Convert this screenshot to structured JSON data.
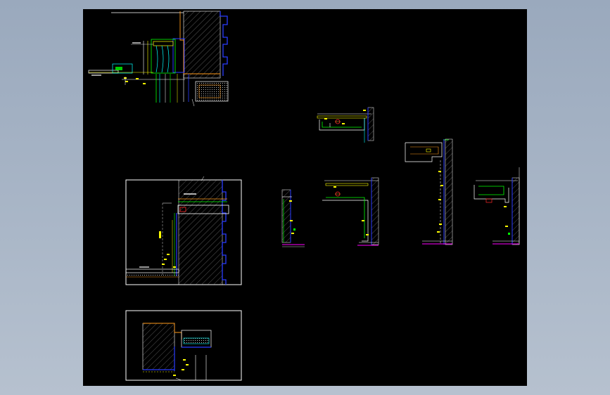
{
  "viewport": {
    "background": "#a6b3c5",
    "canvas_color": "#000000"
  },
  "palette": {
    "white": "#ffffff",
    "yellow": "#ffff00",
    "green": "#00ff00",
    "cyan": "#00ffff",
    "blue": "#2a3cff",
    "orange": "#ff9a1a",
    "red": "#ff2a2a",
    "magenta": "#ff00ff",
    "gray": "#8c8c8c"
  },
  "details": [
    {
      "name": "wall-section-top-left",
      "kind": "section"
    },
    {
      "name": "wall-section-middle-left",
      "kind": "detail"
    },
    {
      "name": "wall-section-bottom-left",
      "kind": "detail"
    },
    {
      "name": "ceiling-detail-1",
      "kind": "detail"
    },
    {
      "name": "ceiling-detail-2",
      "kind": "detail"
    },
    {
      "name": "ceiling-detail-3",
      "kind": "detail"
    },
    {
      "name": "ceiling-detail-4",
      "kind": "detail"
    },
    {
      "name": "ceiling-detail-5",
      "kind": "detail"
    }
  ]
}
